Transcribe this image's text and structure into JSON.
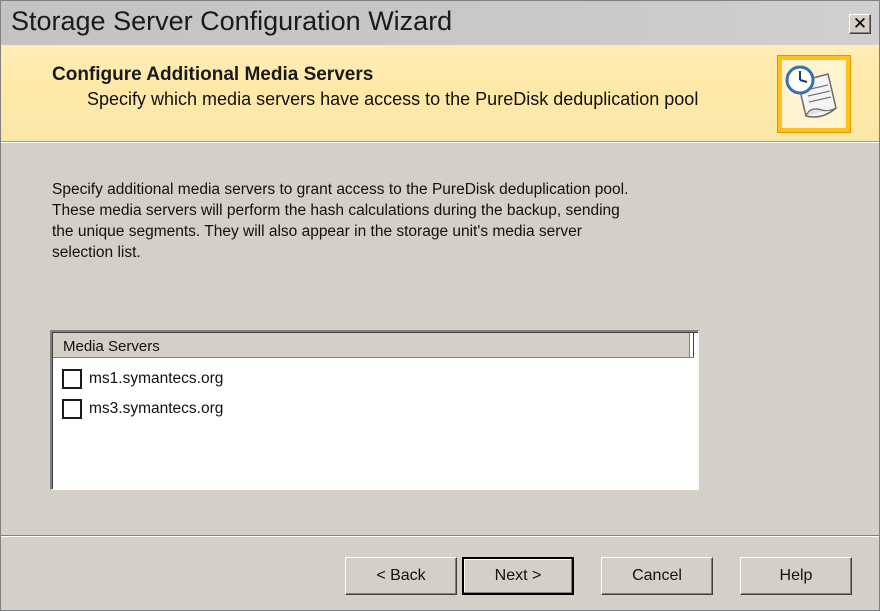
{
  "window": {
    "title": "Storage Server Configuration Wizard",
    "close_icon": "close-icon"
  },
  "header": {
    "title": "Configure Additional Media Servers",
    "subtitle": "Specify which media servers have access to the PureDisk deduplication pool",
    "icon": "wizard-document-clock-icon"
  },
  "description": {
    "lines": [
      "Specify additional media servers to grant access to the PureDisk deduplication pool.",
      "These media servers will perform the hash calculations during the backup, sending",
      "the unique segments. They will also appear in the storage unit's media server",
      "selection list."
    ]
  },
  "media_servers": {
    "column_header": "Media Servers",
    "items": [
      {
        "label": "ms1.symantecs.org",
        "checked": false
      },
      {
        "label": "ms3.symantecs.org",
        "checked": false
      }
    ]
  },
  "buttons": {
    "back": "< Back",
    "next": "Next >",
    "cancel": "Cancel",
    "help": "Help"
  },
  "colors": {
    "header_background": "#ffe9a8",
    "icon_frame": "#ffc21c",
    "dialog_background": "#d4d0c8"
  }
}
